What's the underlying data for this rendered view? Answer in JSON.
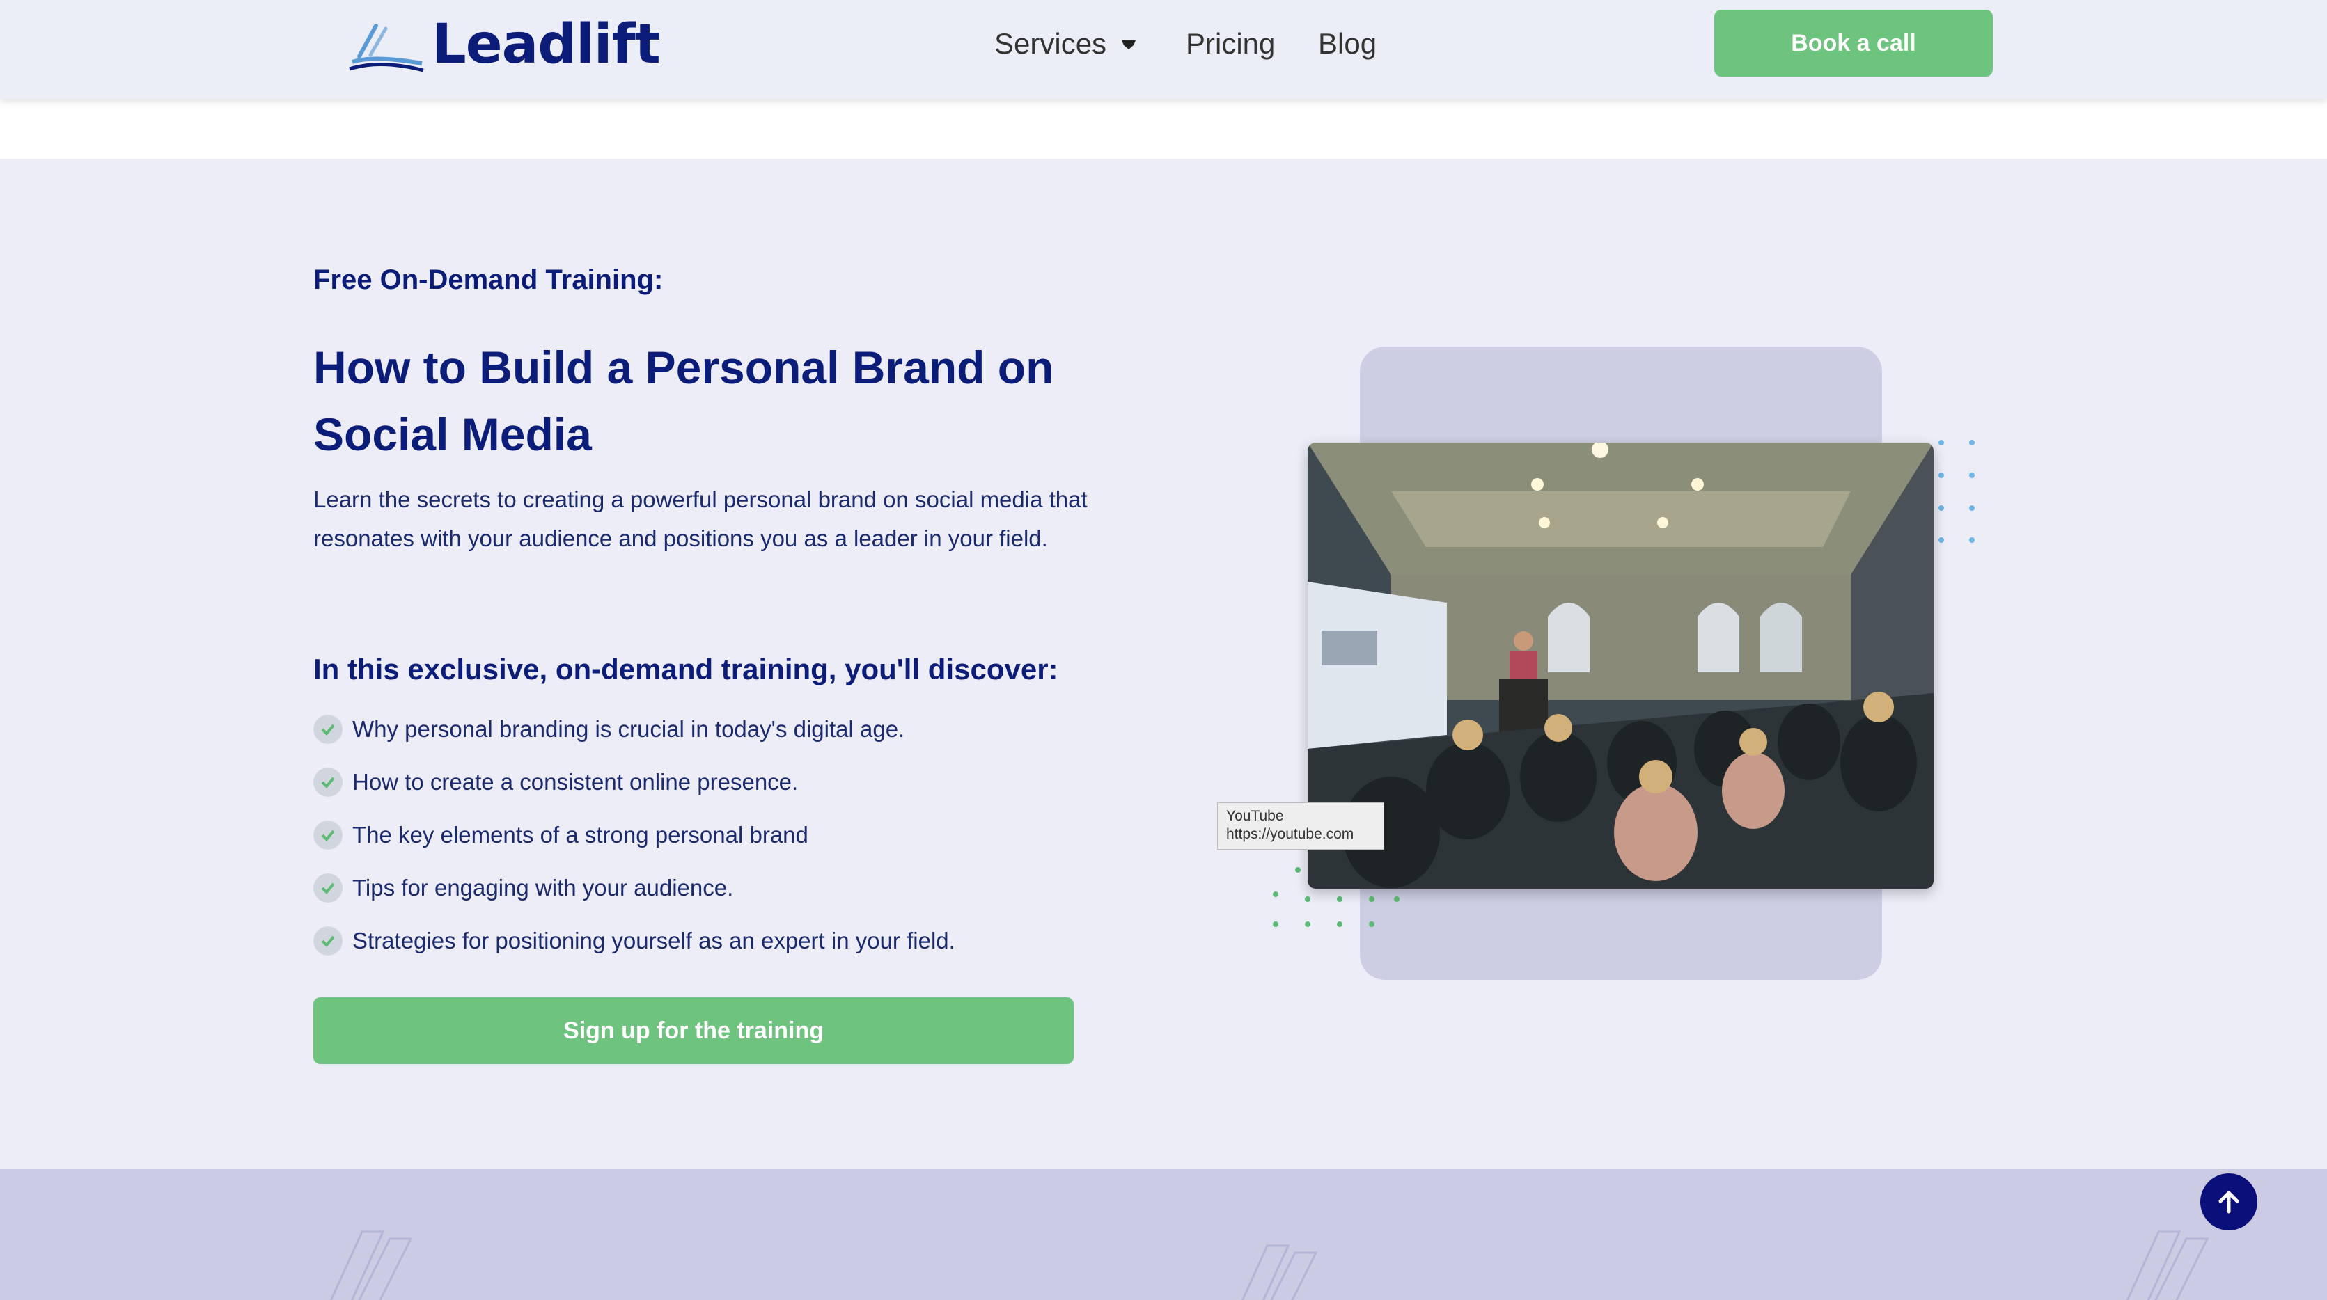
{
  "header": {
    "logo_text": "Leadlift",
    "nav": {
      "services": "Services",
      "pricing": "Pricing",
      "blog": "Blog"
    },
    "cta_label": "Book a call"
  },
  "hero": {
    "kicker": "Free On-Demand Training:",
    "title": "How to Build a Personal Brand on Social Media",
    "description": "Learn the secrets to creating a powerful personal brand on social media that resonates with your audience and positions you as a leader in your field.",
    "subheading": "In this exclusive, on-demand training, you'll discover:",
    "benefits": [
      "Why personal branding is crucial in today's digital age.",
      "How to create a consistent online presence.",
      "The key elements of a strong personal brand",
      "Tips for engaging with your audience.",
      "Strategies for positioning yourself as an expert in your field."
    ],
    "signup_label": "Sign up for the training"
  },
  "media": {
    "tooltip_title": "YouTube",
    "tooltip_url": "https://youtube.com"
  },
  "icons": {
    "services_chevron": "chevron-down-icon",
    "benefit_check": "check-circle-icon",
    "scroll_top": "arrow-up-icon"
  },
  "colors": {
    "brand_navy": "#0b1d78",
    "accent_green": "#6ec47f",
    "section_bg": "#ecedf7",
    "backdrop": "#cdcee4"
  }
}
